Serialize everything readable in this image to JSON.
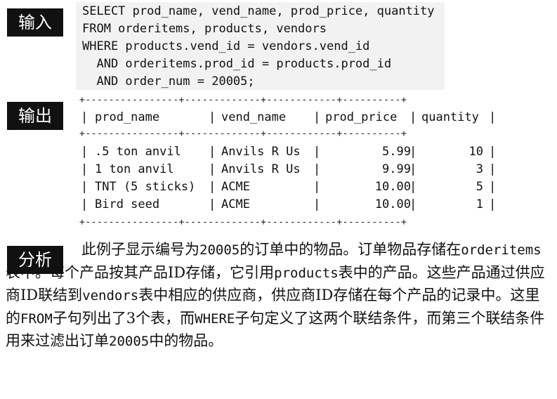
{
  "tags": {
    "input": "输入",
    "output": "输出",
    "analysis": "分析"
  },
  "sql": [
    "SELECT prod_name, vend_name, prod_price, quantity",
    "FROM orderitems, products, vendors",
    "WHERE products.vend_id = vendors.vend_id",
    "  AND orderitems.prod_id = products.prod_id",
    "  AND order_num = 20005;"
  ],
  "result_table": {
    "border": "+----------------+-------------+------------+----------+",
    "headers": [
      "prod_name",
      "vend_name",
      "prod_price",
      "quantity"
    ],
    "rows": [
      [
        ".5 ton anvil",
        "Anvils R Us",
        "5.99",
        "10"
      ],
      [
        "1 ton anvil",
        "Anvils R Us",
        "9.99",
        "3"
      ],
      [
        "TNT (5 sticks)",
        "ACME",
        "10.00",
        "5"
      ],
      [
        "Bird seed",
        "ACME",
        "10.00",
        "1"
      ]
    ]
  },
  "analysis": {
    "s1": "此例子显示编号为",
    "c1": "20005",
    "s2": "的订单中的物品。订单物品存储在",
    "c2": "orderitems",
    "s3": "表中。每个产品按其产品ID存储，它引用",
    "c3": "products",
    "s4": "表中的产品。这些产品通过供应商ID联结到",
    "c4": "vendors",
    "s5": "表中相应的供应商，供应商ID存储在每个产品的记录中。这里的",
    "c5": "FROM",
    "s6": "子句列出了3个表，而",
    "c6": "WHERE",
    "s7": "子句定义了这两个联结条件，而第三个联结条件用来过滤出订单",
    "c7": "20005",
    "s8": "中的物品。"
  }
}
